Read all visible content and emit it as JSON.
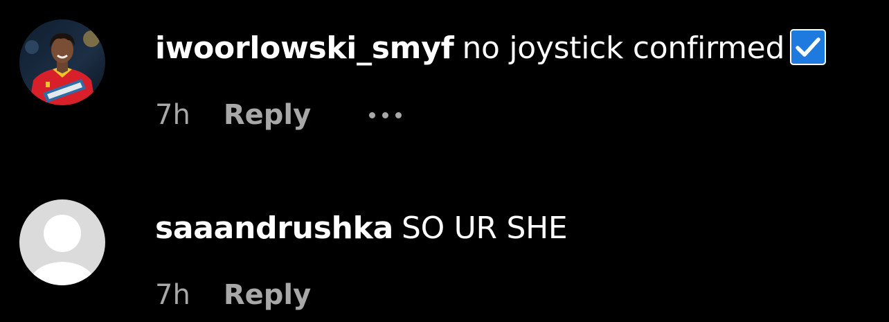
{
  "comments": [
    {
      "username": "iwoorlowski_smyf",
      "text": "no joystick confirmed",
      "emoji": "check-mark-button",
      "time": "7h",
      "reply_label": "Reply",
      "has_more_menu": true,
      "avatar": "profile-photo"
    },
    {
      "username": "saaandrushka",
      "text": "SO UR SHE",
      "time": "7h",
      "reply_label": "Reply",
      "has_more_menu": false,
      "avatar": "default-avatar"
    }
  ],
  "colors": {
    "background": "#000000",
    "primary_text": "#ffffff",
    "secondary_text": "#a8a8a8",
    "check_box": "#1f7ae0",
    "default_avatar_bg": "#dbdbdb"
  }
}
